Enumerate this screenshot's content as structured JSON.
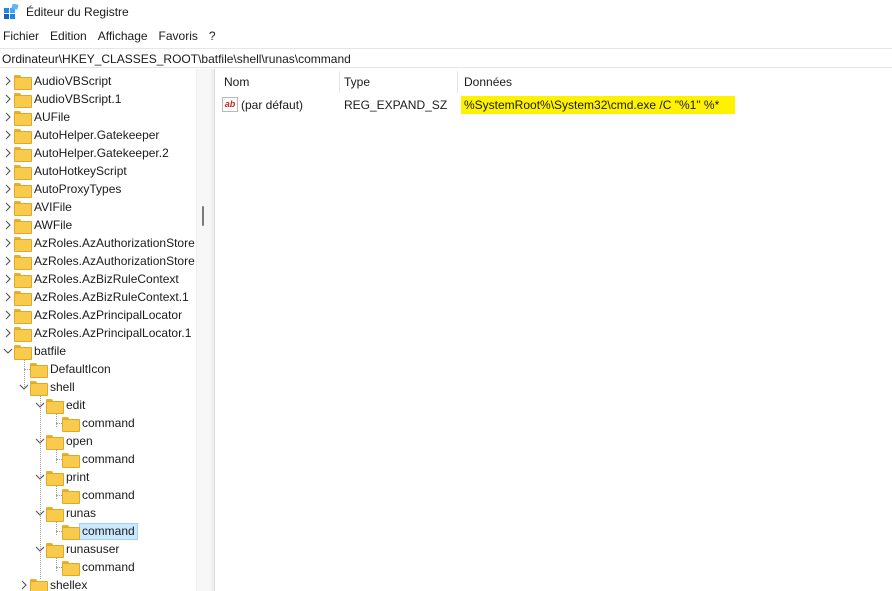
{
  "window": {
    "title": "Éditeur du Registre",
    "app_icon": "registry-editor-icon"
  },
  "menu": [
    "Fichier",
    "Edition",
    "Affichage",
    "Favoris",
    "?"
  ],
  "address": "Ordinateur\\HKEY_CLASSES_ROOT\\batfile\\shell\\runas\\command",
  "tree": {
    "selected": "command",
    "items": [
      {
        "label": "AudioVBScript",
        "expander": "collapsed"
      },
      {
        "label": "AudioVBScript.1",
        "expander": "collapsed"
      },
      {
        "label": "AUFile",
        "expander": "collapsed"
      },
      {
        "label": "AutoHelper.Gatekeeper",
        "expander": "collapsed"
      },
      {
        "label": "AutoHelper.Gatekeeper.2",
        "expander": "collapsed"
      },
      {
        "label": "AutoHotkeyScript",
        "expander": "collapsed"
      },
      {
        "label": "AutoProxyTypes",
        "expander": "collapsed"
      },
      {
        "label": "AVIFile",
        "expander": "collapsed"
      },
      {
        "label": "AWFile",
        "expander": "collapsed"
      },
      {
        "label": "AzRoles.AzAuthorizationStore",
        "expander": "collapsed"
      },
      {
        "label": "AzRoles.AzAuthorizationStore",
        "expander": "collapsed"
      },
      {
        "label": "AzRoles.AzBizRuleContext",
        "expander": "collapsed"
      },
      {
        "label": "AzRoles.AzBizRuleContext.1",
        "expander": "collapsed"
      },
      {
        "label": "AzRoles.AzPrincipalLocator",
        "expander": "collapsed"
      },
      {
        "label": "AzRoles.AzPrincipalLocator.1",
        "expander": "collapsed"
      },
      {
        "label": "batfile",
        "expander": "expanded"
      },
      {
        "label": "DefaultIcon",
        "expander": "none"
      },
      {
        "label": "shell",
        "expander": "expanded"
      },
      {
        "label": "edit",
        "expander": "expanded"
      },
      {
        "label": "command",
        "expander": "none"
      },
      {
        "label": "open",
        "expander": "expanded"
      },
      {
        "label": "command",
        "expander": "none"
      },
      {
        "label": "print",
        "expander": "expanded"
      },
      {
        "label": "command",
        "expander": "none"
      },
      {
        "label": "runas",
        "expander": "expanded"
      },
      {
        "label": "command",
        "expander": "none"
      },
      {
        "label": "runasuser",
        "expander": "expanded"
      },
      {
        "label": "command",
        "expander": "none"
      },
      {
        "label": "shellex",
        "expander": "collapsed"
      }
    ]
  },
  "list": {
    "columns": [
      "Nom",
      "Type",
      "Données"
    ],
    "rows": [
      {
        "name": "(par défaut)",
        "type": "REG_EXPAND_SZ",
        "data": "%SystemRoot%\\System32\\cmd.exe /C \"%1\" %*",
        "icon": "string-value-icon",
        "icon_text": "ab"
      }
    ]
  },
  "colors": {
    "highlight": "#fff200",
    "selection": "#cce8ff",
    "folder": "#f8cb4d"
  }
}
